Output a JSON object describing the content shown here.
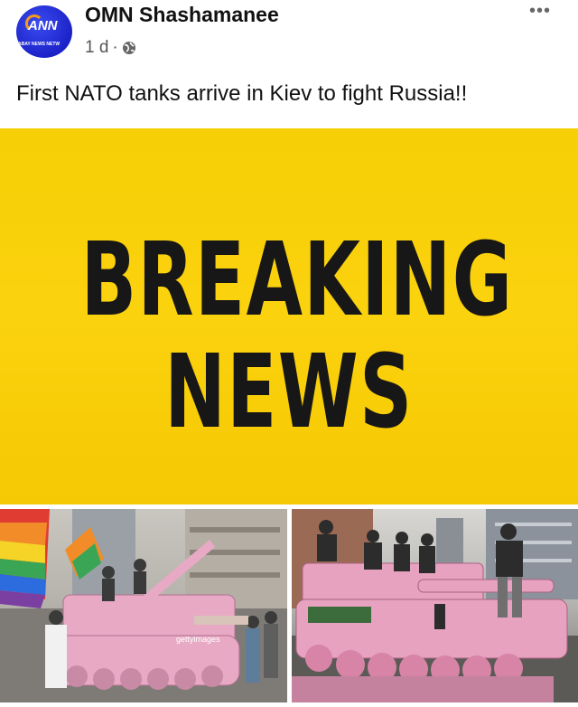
{
  "post": {
    "avatar_text": "ANN",
    "avatar_subtext": "ABAY NEWS NETW",
    "page_name": "OMN Shashamanee",
    "time": "1 d",
    "separator": "·",
    "audience_icon": "globe-icon",
    "more_icon": "more-options-icon",
    "more_label": "•••",
    "text": "First NATO tanks arrive in Kiev to fight Russia!!"
  },
  "banner": {
    "line1": "BREAKING",
    "line2": "NEWS",
    "bg_color": "#f8cf08",
    "text_color": "#171717"
  },
  "photos": {
    "left_watermark": "gettyimages",
    "tank_color": "#e8a9c4"
  }
}
